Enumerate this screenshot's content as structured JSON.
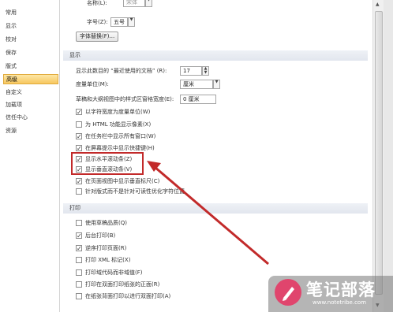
{
  "sidebar": {
    "items": [
      {
        "label": "常用"
      },
      {
        "label": "显示"
      },
      {
        "label": "校对"
      },
      {
        "label": "保存"
      },
      {
        "label": "版式"
      },
      {
        "label": "高级"
      },
      {
        "label": "自定义"
      },
      {
        "label": "加载项"
      },
      {
        "label": "信任中心"
      },
      {
        "label": "资源"
      }
    ],
    "active_index": 5
  },
  "top": {
    "font_name_label": "名称(L):",
    "font_name_value": "宋体",
    "font_size_label": "字号(Z):",
    "font_size_value": "五号",
    "font_substitution_button": "字体替换(F)..."
  },
  "display_section": {
    "title": "显示",
    "recent_docs_label": "显示此数目的 “最近使用的文档” (R):",
    "recent_docs_value": "17",
    "units_label": "度量单位(M):",
    "units_value": "厘米",
    "style_width_label": "草稿和大纲视图中的样式区窗格宽度(E):",
    "style_width_value": "0 厘米",
    "options": [
      {
        "label": "以字符宽度为度量单位(W)",
        "checked": true
      },
      {
        "label": "为 HTML 功能显示像素(X)",
        "checked": false
      },
      {
        "label": "在任务栏中显示所有窗口(W)",
        "checked": true
      },
      {
        "label": "在屏幕提示中显示快捷键(H)",
        "checked": true
      },
      {
        "label": "显示水平滚动条(Z)",
        "checked": true
      },
      {
        "label": "显示垂直滚动条(V)",
        "checked": true
      },
      {
        "label": "在页面视图中显示垂直标尺(C)",
        "checked": true
      },
      {
        "label": "针对版式而不是针对可读性优化字符位置",
        "checked": false
      }
    ]
  },
  "print_section": {
    "title": "打印",
    "options": [
      {
        "label": "使用草稿品质(Q)",
        "checked": false
      },
      {
        "label": "后台打印(B)",
        "checked": true
      },
      {
        "label": "逆序打印页面(R)",
        "checked": true
      },
      {
        "label": "打印 XML 标记(X)",
        "checked": false
      },
      {
        "label": "打印域代码而非域值(F)",
        "checked": false
      },
      {
        "label": "打印在双面打印纸张的正面(R)",
        "checked": false
      },
      {
        "label": "在纸张背面打印以进行双面打印(A)",
        "checked": false
      }
    ]
  },
  "watermark": {
    "title": "笔记部落",
    "url": "www.notetribe.com"
  },
  "colors": {
    "highlight_box": "#c22a2a",
    "active_nav": "#f7c75f"
  }
}
